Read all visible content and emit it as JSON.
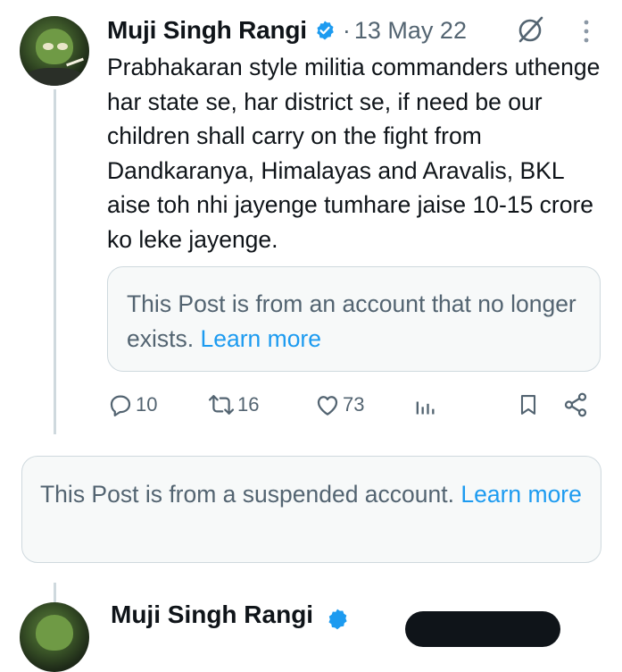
{
  "post": {
    "author_name": "Muji Singh Rangi",
    "separator": "·",
    "date": "13 May 22",
    "text": "Prabhakaran style militia commanders uthenge har state se, har district se, if need be our children shall carry on the fight from Dandkaranya, Himalayas and Aravalis, BKL aise toh nhi jayenge tumhare jaise 10-15 crore ko leke jayenge.",
    "quoted_notice": {
      "message": "This Post is from an account that no longer exists.",
      "link": "Learn more"
    },
    "actions": {
      "replies": "10",
      "reposts": "16",
      "likes": "73"
    }
  },
  "suspended_notice": {
    "message": "This Post is from a suspended account.",
    "link": "Learn more"
  },
  "next_post": {
    "author_name": "Muji Singh Rangi"
  },
  "icons": {
    "verified": "verified-badge-icon",
    "grok": "grok-icon",
    "more": "more-dots-icon",
    "reply": "reply-icon",
    "repost": "repost-icon",
    "like": "heart-icon",
    "views": "views-icon",
    "bookmark": "bookmark-icon",
    "share": "share-icon"
  },
  "colors": {
    "accent": "#1d9bf0",
    "secondary_text": "#536471",
    "primary_text": "#0f1419",
    "card_background": "#f7f9f9",
    "border": "#cfd9de"
  }
}
